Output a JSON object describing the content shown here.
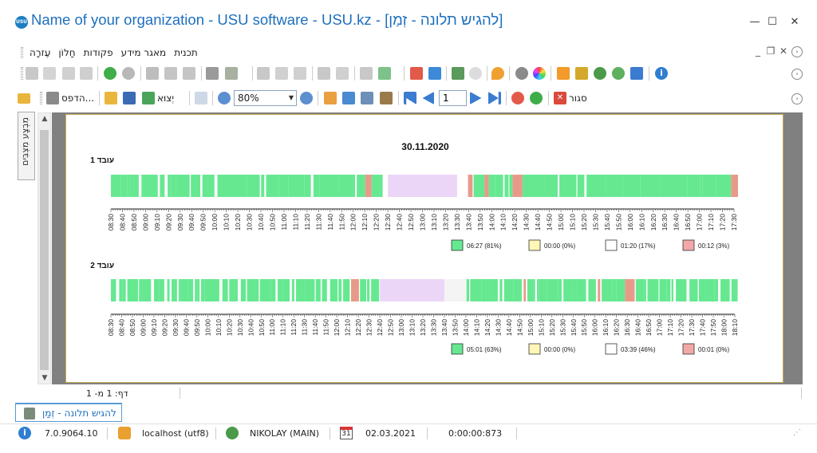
{
  "window": {
    "title": "Name of your organization - USU software - USU.kz - [להגיש תלונה - זְמַן]",
    "logo_text": "USU",
    "controls": {
      "minimize": "—",
      "maximize": "☐",
      "close": "✕"
    }
  },
  "menu": {
    "items": [
      "תכנית",
      "מאגר מידע",
      "פקודות",
      "חַלוֹן",
      "עֶזרָה"
    ],
    "mdi_controls": {
      "minimize": "_",
      "restore": "❐",
      "close": "✕"
    }
  },
  "print_toolbar": {
    "print_label": "הדפס...",
    "export_label": "יְצוּא",
    "zoom_value": "80%",
    "page_value": "1",
    "close_label": "סגור"
  },
  "side_panel": {
    "label": "מִבְצָע מִצְבִּים"
  },
  "report": {
    "date": "30.11.2020",
    "employees": [
      {
        "name": "עובד 1",
        "ticks": [
          "08:30",
          "08:40",
          "08:50",
          "09:00",
          "09:10",
          "09:20",
          "09:30",
          "09:40",
          "09:50",
          "10:00",
          "10:10",
          "10:20",
          "10:30",
          "10:40",
          "10:50",
          "11:00",
          "11:10",
          "11:20",
          "11:30",
          "11:40",
          "11:50",
          "12:00",
          "12:10",
          "12:20",
          "12:30",
          "12:40",
          "12:50",
          "13:00",
          "13:10",
          "13:20",
          "13:30",
          "13:40",
          "13:50",
          "14:00",
          "14:10",
          "14:20",
          "14:30",
          "14:40",
          "14:50",
          "15:00",
          "15:10",
          "15:20",
          "15:30",
          "15:40",
          "15:50",
          "16:00",
          "16:10",
          "16:20",
          "16:30",
          "16:40",
          "16:50",
          "17:00",
          "17:10",
          "17:20",
          "17:30"
        ],
        "legend": [
          "06:27 (81%)",
          "00:00 (0%)",
          "01:20 (17%)",
          "00:12 (3%)"
        ]
      },
      {
        "name": "עובד 2",
        "ticks": [
          "08:30",
          "08:40",
          "08:50",
          "09:00",
          "09:10",
          "09:20",
          "09:30",
          "09:40",
          "09:50",
          "10:00",
          "10:10",
          "10:20",
          "10:30",
          "10:40",
          "10:50",
          "11:00",
          "11:10",
          "11:20",
          "11:30",
          "11:40",
          "11:50",
          "12:00",
          "12:10",
          "12:20",
          "12:30",
          "12:40",
          "12:50",
          "13:00",
          "13:10",
          "13:20",
          "13:30",
          "13:40",
          "13:50",
          "14:00",
          "14:10",
          "14:20",
          "14:30",
          "14:40",
          "14:50",
          "15:00",
          "15:10",
          "15:20",
          "15:30",
          "15:40",
          "15:50",
          "16:00",
          "16:10",
          "16:20",
          "16:30",
          "16:40",
          "16:50",
          "17:00",
          "17:10",
          "17:20",
          "17:30",
          "17:40",
          "17:50",
          "18:00",
          "18:10"
        ],
        "legend": [
          "05:01 (63%)",
          "00:00 (0%)",
          "03:39 (46%)",
          "00:01 (0%)"
        ]
      }
    ],
    "legend_colors": [
      "#66e891",
      "#fff7b8",
      "#ffffff",
      "#f3a8a8"
    ],
    "colors": {
      "active": "#66e891",
      "lunch": "#ecd6f7",
      "idle": "#f4f4f4",
      "alert": "#e89a8a"
    }
  },
  "status": {
    "page_info": "דף: 1 מ- 1",
    "doc_tab": "להגיש תלונה - זְמַן",
    "version": "7.0.9064.10",
    "db": "localhost (utf8)",
    "user": "NIKOLAY (MAIN)",
    "calendar_day": "31",
    "date": "02.03.2021",
    "timer": "0:00:00:873"
  }
}
